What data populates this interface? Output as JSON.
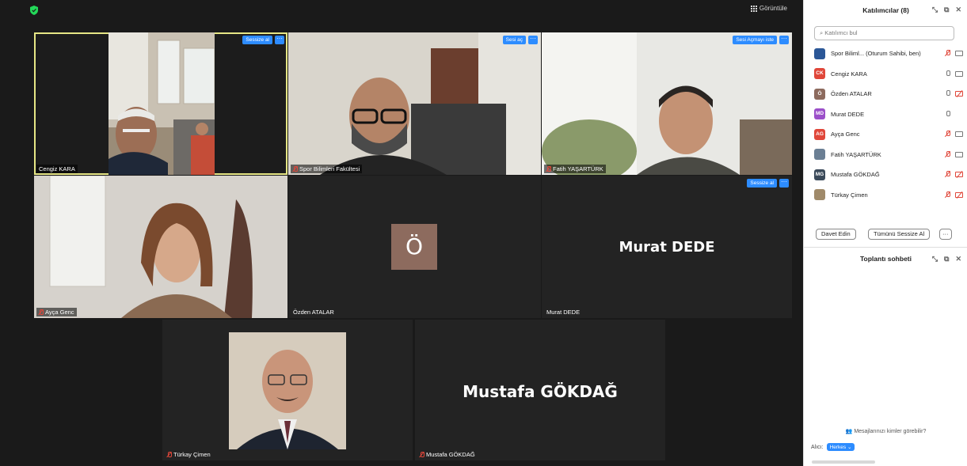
{
  "top_bar": {
    "view_label": "Görüntüle"
  },
  "tiles": {
    "cengiz": {
      "name": "Cengiz KARA",
      "button": "Sessize al",
      "more": "···"
    },
    "spor": {
      "name": "Spor Bilimleri Fakültesi",
      "button": "Sesi aç",
      "more": "···"
    },
    "fatih": {
      "name": "Fatih YAŞARTÜRK",
      "button": "Sesi Açmayı iste",
      "more": "···"
    },
    "ayca": {
      "name": "Ayça Genc"
    },
    "ozden": {
      "name": "Özden ATALAR",
      "avatar": "Ö"
    },
    "murat": {
      "name": "Murat DEDE",
      "display": "Murat DEDE",
      "button": "Sessize al",
      "more": "···"
    },
    "turkay": {
      "name": "Türkay Çimen"
    },
    "mustafa": {
      "name": "Mustafa GÖKDAĞ",
      "display": "Mustafa GÖKDAĞ"
    }
  },
  "participants_panel": {
    "title": "Katılımcılar (8)",
    "search_placeholder": "Katılımcı bul",
    "participants": [
      {
        "initials": "",
        "name": "Spor Biliml...  (Oturum Sahibi, ben)",
        "color": "#2b5797",
        "mic": "off",
        "cam": "on"
      },
      {
        "initials": "CK",
        "name": "Cengiz KARA",
        "color": "#e0473a",
        "mic": "on",
        "cam": "on"
      },
      {
        "initials": "Ö",
        "name": "Özden ATALAR",
        "color": "#8d6b5e",
        "mic": "on",
        "cam": "off"
      },
      {
        "initials": "MD",
        "name": "Murat DEDE",
        "color": "#9b4fc9",
        "mic": "on",
        "cam": "none"
      },
      {
        "initials": "AG",
        "name": "Ayça Genc",
        "color": "#e0473a",
        "mic": "off",
        "cam": "on"
      },
      {
        "initials": "",
        "name": "Fatih YAŞARTÜRK",
        "color": "#6b7f94",
        "mic": "off",
        "cam": "on"
      },
      {
        "initials": "MG",
        "name": "Mustafa GÖKDAĞ",
        "color": "#3b4a5a",
        "mic": "off",
        "cam": "off"
      },
      {
        "initials": "",
        "name": "Türkay Çimen",
        "color": "#a08a6a",
        "mic": "off",
        "cam": "off"
      }
    ],
    "invite_label": "Davet Edin",
    "mute_all_label": "Tümünü Sessize Al",
    "more_label": "···"
  },
  "chat_panel": {
    "title": "Toplantı sohbeti",
    "who_sees": "Mesajlarınızı kimler görebilir?",
    "to_label": "Alıcı:",
    "to_value": "Herkes"
  },
  "colors": {
    "accent": "#2d8cff",
    "active_speaker": "#e6e685",
    "muted": "#e0473a"
  }
}
